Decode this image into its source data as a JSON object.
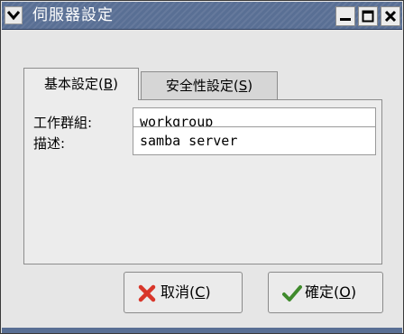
{
  "window": {
    "title": "伺服器設定"
  },
  "tabs": [
    {
      "label": "基本設定(",
      "mnemonic": "B",
      "suffix": ")",
      "selected": true
    },
    {
      "label": "安全性設定(",
      "mnemonic": "S",
      "suffix": ")",
      "selected": false
    }
  ],
  "fields": {
    "workgroup": {
      "label": "工作群組:",
      "value": "workgroup"
    },
    "description": {
      "label": "描述:",
      "value": "samba server"
    }
  },
  "buttons": {
    "cancel": {
      "label": "取消(",
      "mnemonic": "C",
      "suffix": ")",
      "icon": "x-icon"
    },
    "ok": {
      "label": "確定(",
      "mnemonic": "O",
      "suffix": ")",
      "icon": "checkmark-icon"
    }
  },
  "colors": {
    "titlebar": "#596f94",
    "cancel_icon": "#d8362a",
    "ok_icon": "#3f8a2c"
  }
}
